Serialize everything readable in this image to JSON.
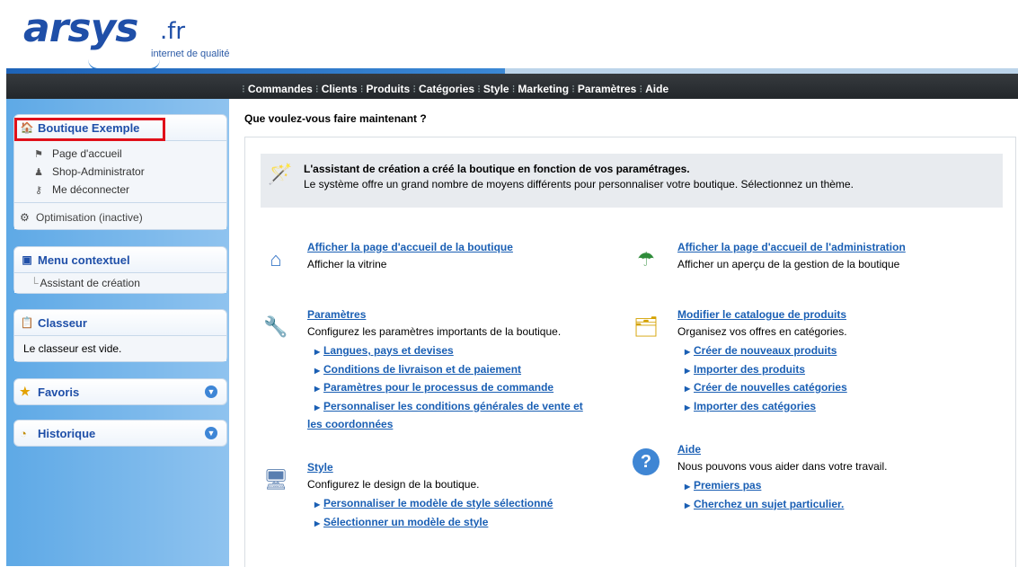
{
  "logo": {
    "brand": "arsys",
    "tld": ".fr",
    "tagline": "internet de qualité"
  },
  "menu": [
    "Commandes",
    "Clients",
    "Produits",
    "Catégories",
    "Style",
    "Marketing",
    "Paramètres",
    "Aide"
  ],
  "sidebar": {
    "shop": {
      "title": "Boutique Exemple",
      "items": [
        "Page d'accueil",
        "Shop-Administrator",
        "Me déconnecter"
      ],
      "optim": "Optimisation (inactive)"
    },
    "context": {
      "title": "Menu contextuel",
      "item": "Assistant de création"
    },
    "binder": {
      "title": "Classeur",
      "text": "Le classeur est vide."
    },
    "favorites": {
      "title": "Favoris"
    },
    "history": {
      "title": "Historique"
    }
  },
  "main": {
    "question": "Que voulez-vous faire maintenant ?",
    "banner": {
      "title": "L'assistant de création a créé la boutique en fonction de vos paramétrages.",
      "text": "Le système offre un grand nombre de moyens différents pour personnaliser votre boutique. Sélectionnez un thème."
    },
    "blocks": {
      "home": {
        "title": "Afficher la page d'accueil de la boutique",
        "desc": "Afficher la vitrine"
      },
      "admin": {
        "title": "Afficher la page d'accueil de l'administration",
        "desc": "Afficher un aperçu de la gestion de la boutique"
      },
      "params": {
        "title": "Paramètres",
        "desc": "Configurez les paramètres importants de la boutique.",
        "links": [
          "Langues, pays et devises",
          "Conditions de livraison et de paiement",
          "Paramètres pour le processus de commande",
          "Personnaliser les conditions générales de vente et"
        ],
        "link_cont": "les coordonnées"
      },
      "catalog": {
        "title": "Modifier le catalogue de produits",
        "desc": "Organisez vos offres en catégories.",
        "links": [
          "Créer de nouveaux produits",
          "Importer des produits",
          "Créer de nouvelles catégories",
          "Importer des catégories"
        ]
      },
      "style": {
        "title": "Style",
        "desc": "Configurez le design de la boutique.",
        "links": [
          "Personnaliser le modèle de style sélectionné",
          "Sélectionner un modèle de style"
        ]
      },
      "help": {
        "title": "Aide",
        "desc": "Nous pouvons vous aider dans votre travail.",
        "links": [
          "Premiers pas",
          "Cherchez un sujet particulier."
        ]
      }
    }
  }
}
